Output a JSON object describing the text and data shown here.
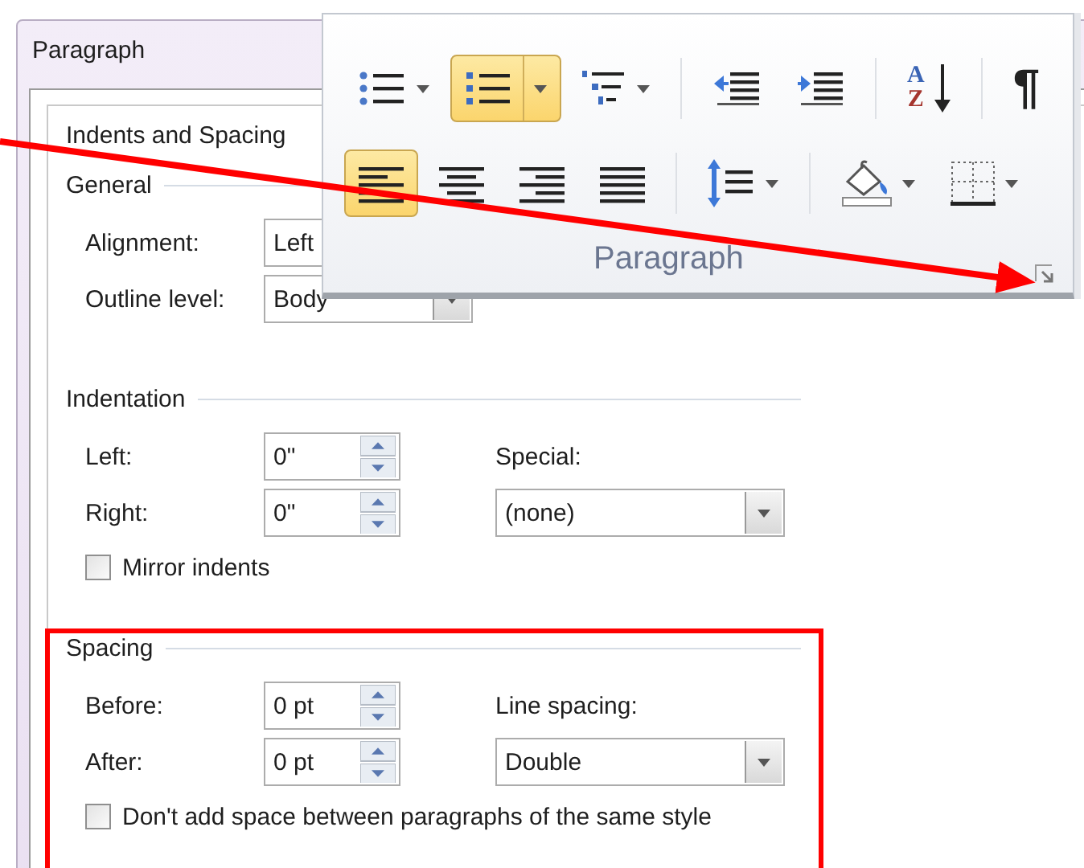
{
  "dialog": {
    "title": "Paragraph",
    "tab": "Indents and Spacing",
    "sections": [
      {
        "heading": "General",
        "fields": [
          {
            "kind": "dropdown",
            "label": "Alignment:",
            "value": "Left"
          },
          {
            "kind": "dropdown",
            "label": "Outline level:",
            "value": "Body"
          }
        ]
      },
      {
        "heading": "Indentation",
        "fields": [
          {
            "kind": "spinner",
            "label": "Left:",
            "value": "0\""
          },
          {
            "kind": "spinner",
            "label": "Right:",
            "value": "0\""
          }
        ],
        "side": {
          "kind": "labeled_dropdown",
          "label": "Special:",
          "value": "(none)"
        },
        "checkbox": {
          "label": "Mirror indents",
          "checked": false
        }
      },
      {
        "heading": "Spacing",
        "fields": [
          {
            "kind": "spinner",
            "label": "Before:",
            "value": "0 pt"
          },
          {
            "kind": "spinner",
            "label": "After:",
            "value": "0 pt"
          }
        ],
        "side": {
          "kind": "labeled_dropdown",
          "label": "Line spacing:",
          "value": "Double"
        },
        "checkbox": {
          "label": "Don't add space between paragraphs of the same style",
          "checked": false
        }
      }
    ]
  },
  "ribbon": {
    "group_label": "Paragraph",
    "rows": [
      [
        {
          "kind": "bullets",
          "selected": false
        },
        {
          "kind": "numbering",
          "selected": true
        },
        {
          "kind": "multilevel",
          "selected": false
        },
        {
          "kind": "separator"
        },
        {
          "kind": "decrease_indent",
          "selected": false
        },
        {
          "kind": "increase_indent",
          "selected": false
        },
        {
          "kind": "separator"
        },
        {
          "kind": "sort",
          "selected": false,
          "top": "A",
          "bottom": "Z"
        },
        {
          "kind": "separator"
        },
        {
          "kind": "show_marks",
          "selected": false,
          "glyph": "¶"
        }
      ],
      [
        {
          "kind": "align_left",
          "selected": true
        },
        {
          "kind": "align_center",
          "selected": false
        },
        {
          "kind": "align_right",
          "selected": false
        },
        {
          "kind": "justify",
          "selected": false
        },
        {
          "kind": "separator"
        },
        {
          "kind": "line_spacing",
          "selected": false
        },
        {
          "kind": "separator"
        },
        {
          "kind": "shading",
          "selected": false
        },
        {
          "kind": "borders",
          "selected": false
        }
      ]
    ]
  }
}
